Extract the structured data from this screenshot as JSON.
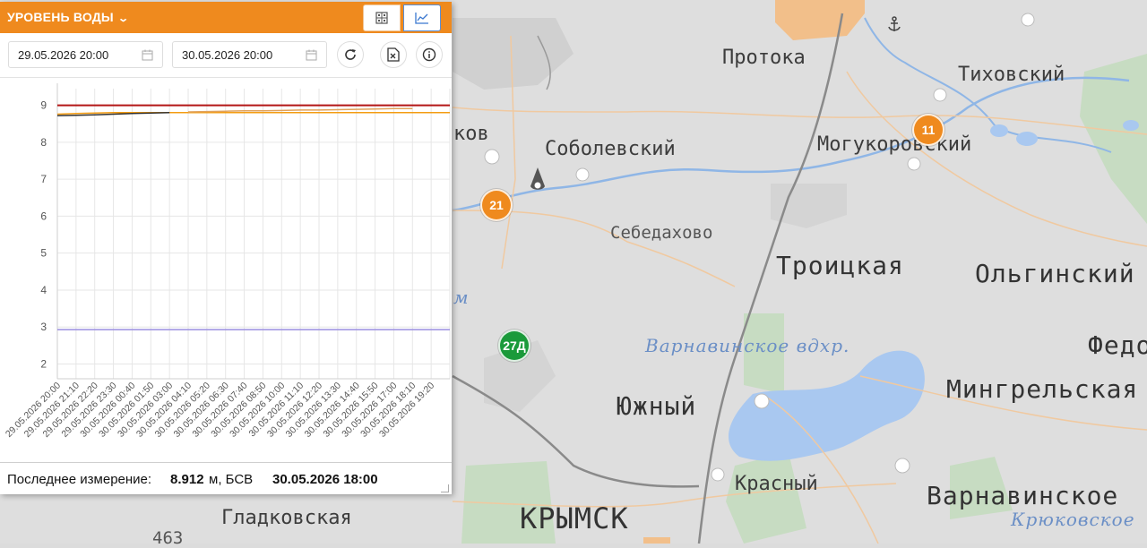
{
  "panel": {
    "title": "УРОВЕНЬ ВОДЫ",
    "accent_color": "#ef8a1e",
    "date_from": "29.05.2026 20:00",
    "date_to": "30.05.2026 20:00",
    "icons": {
      "table_view": "table-icon",
      "chart_view": "line-chart-icon",
      "refresh": "refresh-icon",
      "export": "excel-export-icon",
      "info": "info-icon",
      "calendar": "calendar-icon"
    }
  },
  "chart_data": {
    "type": "line",
    "x": [
      "29.05.2026 20:00",
      "29.05.2026 21:10",
      "29.05.2026 22:20",
      "29.05.2026 23:30",
      "30.05.2026 00:40",
      "30.05.2026 01:50",
      "30.05.2026 03:00",
      "30.05.2026 04:10",
      "30.05.2026 05:20",
      "30.05.2026 06:30",
      "30.05.2026 07:40",
      "30.05.2026 08:50",
      "30.05.2026 10:00",
      "30.05.2026 11:10",
      "30.05.2026 12:20",
      "30.05.2026 13:30",
      "30.05.2026 14:40",
      "30.05.2026 15:50",
      "30.05.2026 17:00",
      "30.05.2026 18:10",
      "30.05.2026 19:20"
    ],
    "y_ticks": [
      2,
      3,
      4,
      5,
      6,
      7,
      8,
      9
    ],
    "ylim": [
      1.6,
      9.45
    ],
    "grid": true,
    "series": [
      {
        "color": "#b31515",
        "values": [
          9.0,
          9.0,
          9.0,
          9.0,
          9.0,
          9.0,
          9.0,
          9.0,
          9.0,
          9.0,
          9.0,
          9.0,
          9.0,
          9.0,
          9.0,
          9.0,
          9.0,
          9.0,
          9.0,
          9.0,
          9.0
        ]
      },
      {
        "color": "#f39c12",
        "values": [
          8.76,
          8.78,
          8.79,
          8.8,
          8.8,
          8.8,
          8.8,
          8.8,
          8.8,
          8.8,
          8.8,
          8.8,
          8.8,
          8.8,
          8.8,
          8.8,
          8.8,
          8.8,
          8.8,
          8.8,
          8.8
        ]
      },
      {
        "color": "#e0a15a",
        "values": [
          null,
          null,
          null,
          null,
          null,
          null,
          null,
          8.82,
          8.83,
          8.84,
          8.85,
          8.85,
          8.86,
          8.87,
          8.87,
          8.88,
          8.89,
          8.9,
          8.91,
          8.91,
          null
        ]
      },
      {
        "color": "#333333",
        "values": [
          8.72,
          8.73,
          8.74,
          8.76,
          8.78,
          8.79,
          8.8,
          null,
          null,
          null,
          null,
          null,
          null,
          null,
          null,
          null,
          null,
          null,
          null,
          null,
          null
        ]
      },
      {
        "color": "#9a8ee0",
        "values": [
          2.93,
          2.93,
          2.93,
          2.93,
          2.93,
          2.93,
          2.93,
          2.93,
          2.93,
          2.93,
          2.93,
          2.93,
          2.93,
          2.93,
          2.93,
          2.93,
          2.93,
          2.93,
          2.93,
          2.93,
          2.93
        ]
      }
    ]
  },
  "footer": {
    "label": "Последнее измерение:",
    "value": "8.912",
    "unit": "м, БСВ",
    "datetime": "30.05.2026 18:00"
  },
  "map": {
    "labels": {
      "protoka": "Протока",
      "tikhovsky": "Тиховский",
      "sobolevsky": "Соболевский",
      "mogukorovsky": "Могукоровский",
      "kov": "ков",
      "sebedakhovo": "Себедахово",
      "troitskaya": "Троицкая",
      "olginsky": "Ольгинский",
      "varnavinskoe_vdkhr": "Варнавинское вдхр.",
      "fedo": "Федо",
      "m_water": "м",
      "yuzhny": "Южный",
      "mingrelskaya": "Мингрельская",
      "krasny": "Красный",
      "varnavinskoe": "Варнавинское",
      "kryukovskoe": "Крюковское",
      "krymsk": "КРЫМСК",
      "gladkovskaya": "Гладковская",
      "n463": "463"
    },
    "markers": {
      "m21": "21",
      "m11": "11",
      "m27d": "27Д"
    },
    "icons": {
      "anchor": "anchor-icon",
      "location_pin": "location-pin-icon"
    }
  }
}
